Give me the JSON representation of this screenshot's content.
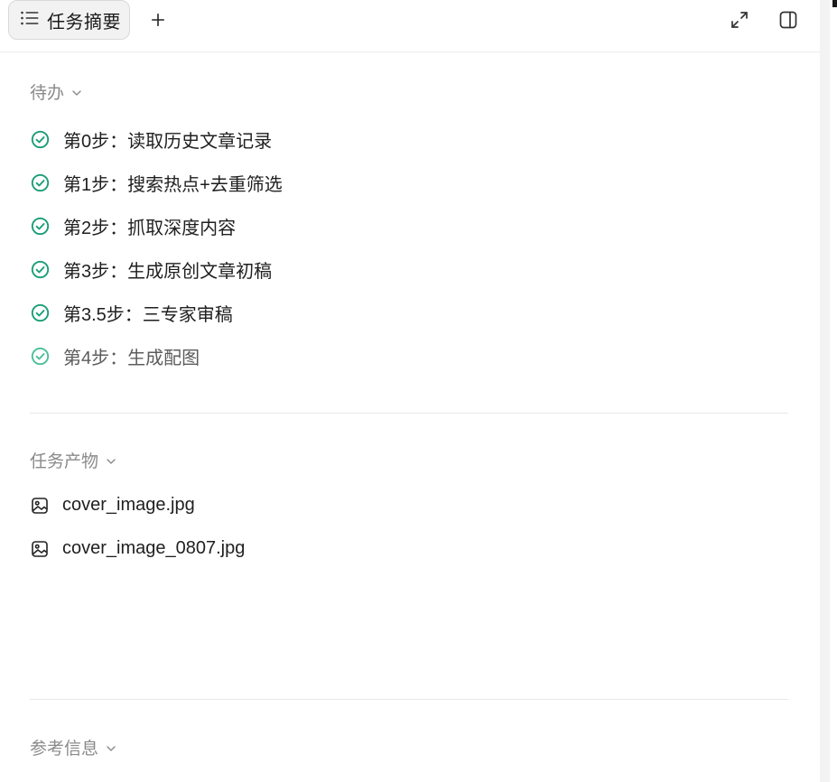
{
  "header": {
    "tab_label": "任务摘要",
    "add_label": "+"
  },
  "todo": {
    "title": "待办",
    "items": [
      {
        "label": "第0步：读取历史文章记录",
        "status": "done"
      },
      {
        "label": "第1步：搜索热点+去重筛选",
        "status": "done"
      },
      {
        "label": "第2步：抓取深度内容",
        "status": "done"
      },
      {
        "label": "第3步：生成原创文章初稿",
        "status": "done"
      },
      {
        "label": "第3.5步：三专家审稿",
        "status": "done"
      },
      {
        "label": "第4步：生成配图",
        "status": "in-progress"
      }
    ]
  },
  "artifacts": {
    "title": "任务产物",
    "items": [
      {
        "label": "cover_image.jpg",
        "icon": "image-file-icon"
      },
      {
        "label": "cover_image_0807.jpg",
        "icon": "image-file-icon"
      }
    ]
  },
  "references": {
    "title": "参考信息"
  },
  "colors": {
    "check_done": "#1a9e77",
    "check_in_progress": "#4cbf97",
    "section_title": "#8a8a8a"
  }
}
